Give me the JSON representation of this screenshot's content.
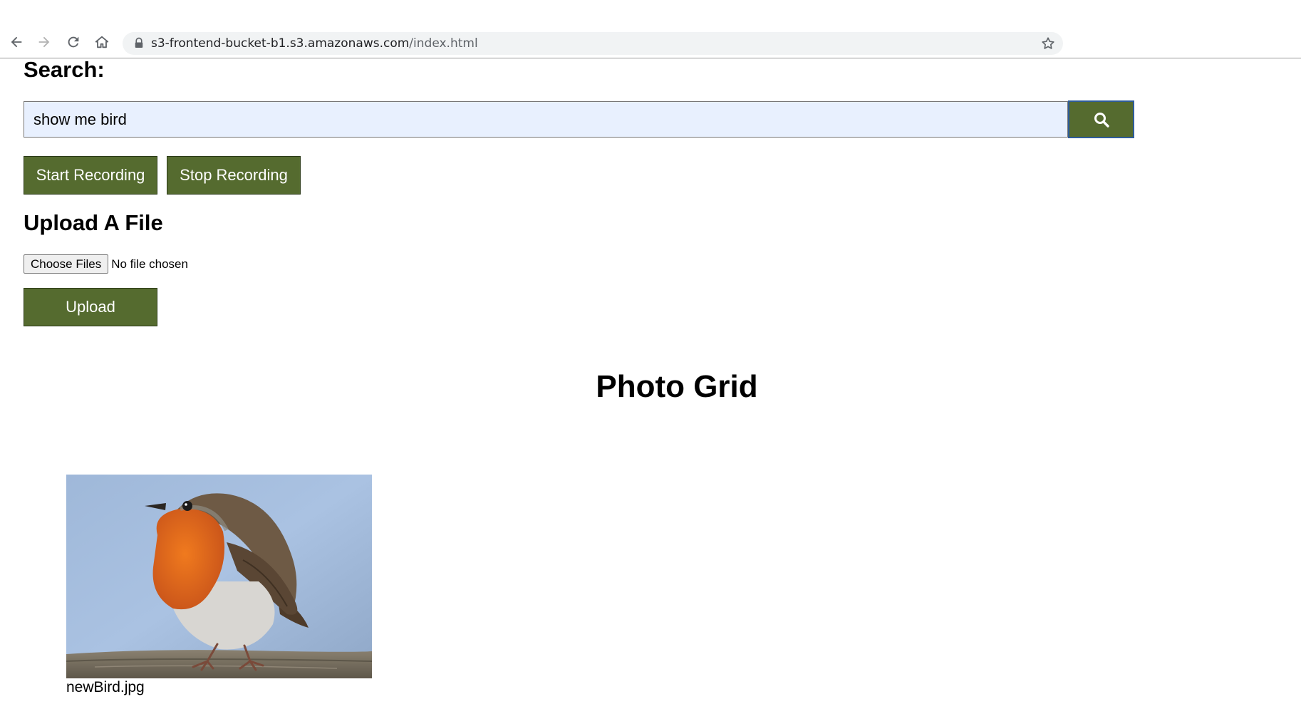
{
  "browser": {
    "url_domain": "s3-frontend-bucket-b1.s3.amazonaws.com",
    "url_path": "/index.html"
  },
  "search": {
    "label": "Search:",
    "value": "show me bird"
  },
  "recording": {
    "start_label": "Start Recording",
    "stop_label": "Stop Recording"
  },
  "upload": {
    "heading": "Upload A File",
    "choose_label": "Choose Files",
    "status": "No file chosen",
    "button_label": "Upload"
  },
  "grid": {
    "title": "Photo Grid",
    "photos": [
      {
        "caption": "newBird.jpg",
        "subject": "robin perched on wooden rail"
      }
    ]
  },
  "colors": {
    "button_green": "#556b2f",
    "input_bg": "#e8f0fe",
    "search_button_border": "#2e5c9a"
  }
}
